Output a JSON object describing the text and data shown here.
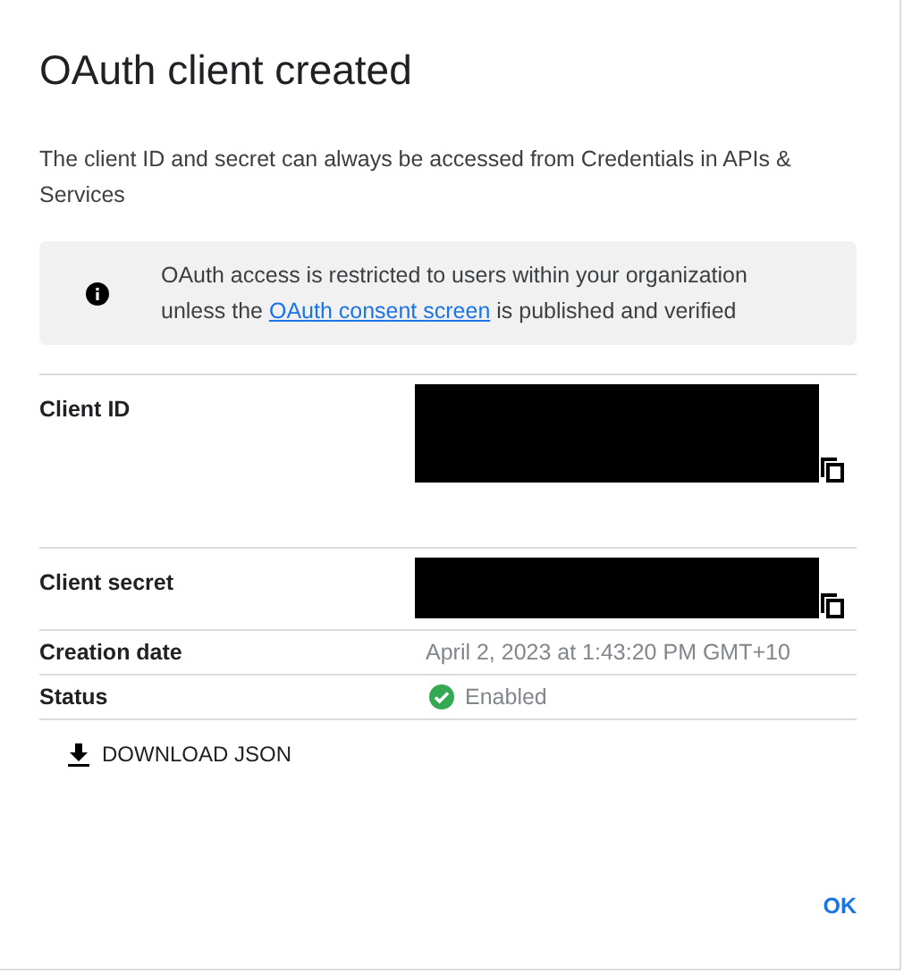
{
  "dialog": {
    "title": "OAuth client created",
    "description": "The client ID and secret can always be accessed from Credentials in APIs & Services",
    "notice": {
      "before": "OAuth access is restricted to users within your organization unless the ",
      "link": "OAuth consent screen",
      "after": " is published and verified"
    },
    "fields": [
      {
        "kind": "identifier",
        "label": "Client ID"
      },
      {
        "kind": "secret",
        "label": "Client secret"
      },
      {
        "kind": "text",
        "label": "Creation date",
        "value": "April 2, 2023 at 1:43:20 PM GMT+10"
      },
      {
        "kind": "status",
        "label": "Status",
        "value": "Enabled"
      }
    ],
    "download_button": "DOWNLOAD JSON",
    "ok_button": "OK"
  }
}
